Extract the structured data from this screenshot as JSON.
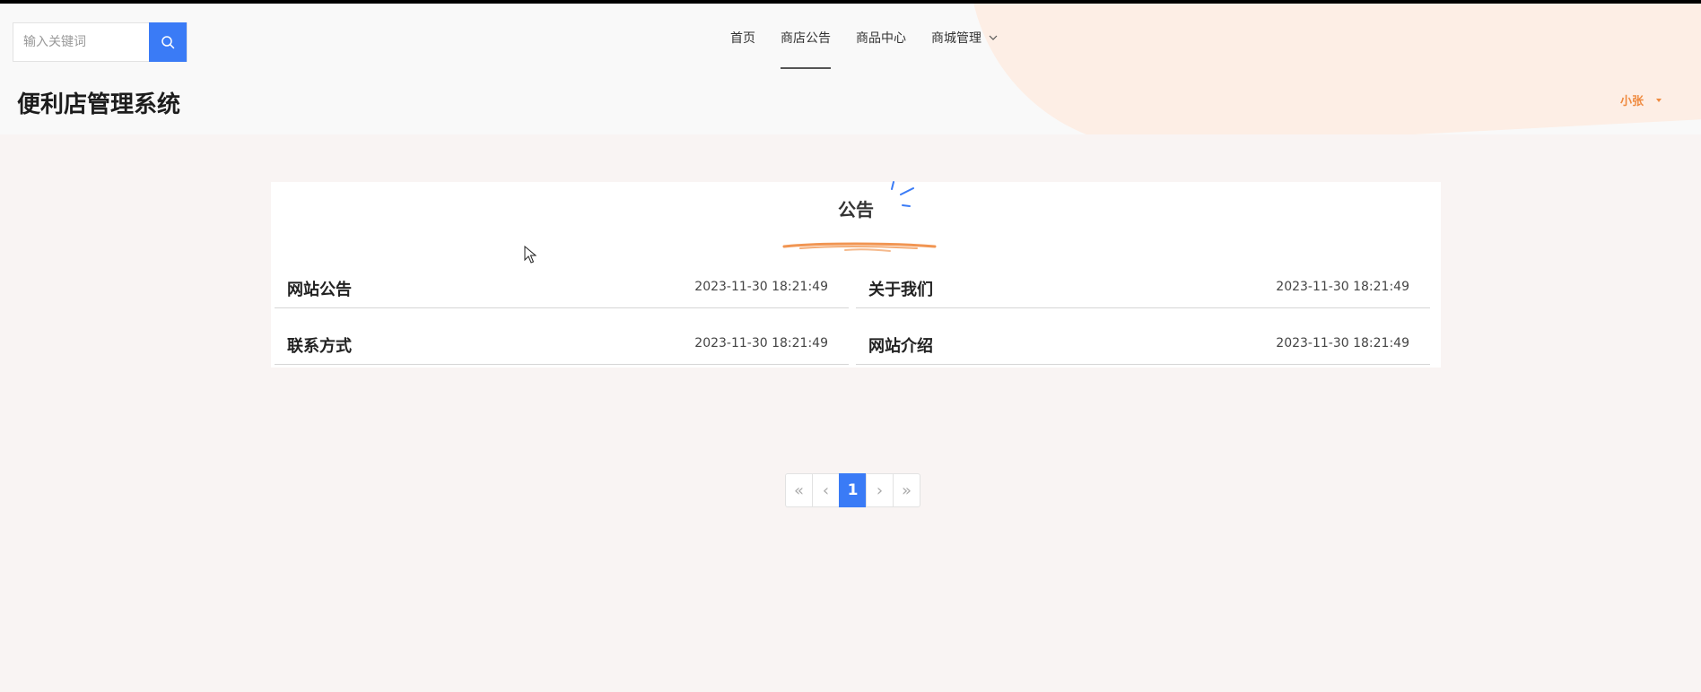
{
  "header": {
    "site_title": "便利店管理系统",
    "search": {
      "placeholder": "输入关键词",
      "value": ""
    },
    "nav": [
      {
        "label": "首页",
        "active": false
      },
      {
        "label": "商店公告",
        "active": true
      },
      {
        "label": "商品中心",
        "active": false
      },
      {
        "label": "商城管理",
        "active": false,
        "has_dropdown": true
      }
    ],
    "user": {
      "name": "小张"
    }
  },
  "notices": {
    "title": "公告",
    "items": [
      {
        "name": "网站公告",
        "date": "2023-11-30 18:21:49"
      },
      {
        "name": "关于我们",
        "date": "2023-11-30 18:21:49"
      },
      {
        "name": "联系方式",
        "date": "2023-11-30 18:21:49"
      },
      {
        "name": "网站介绍",
        "date": "2023-11-30 18:21:49"
      }
    ]
  },
  "pagination": {
    "first": "«",
    "prev": "‹",
    "current": "1",
    "next": "›",
    "last": "»"
  },
  "colors": {
    "accent": "#3a7bf6",
    "user": "#ef8a3f",
    "header_blob": "#fdeee5",
    "page_bg": "#f9f4f3"
  }
}
